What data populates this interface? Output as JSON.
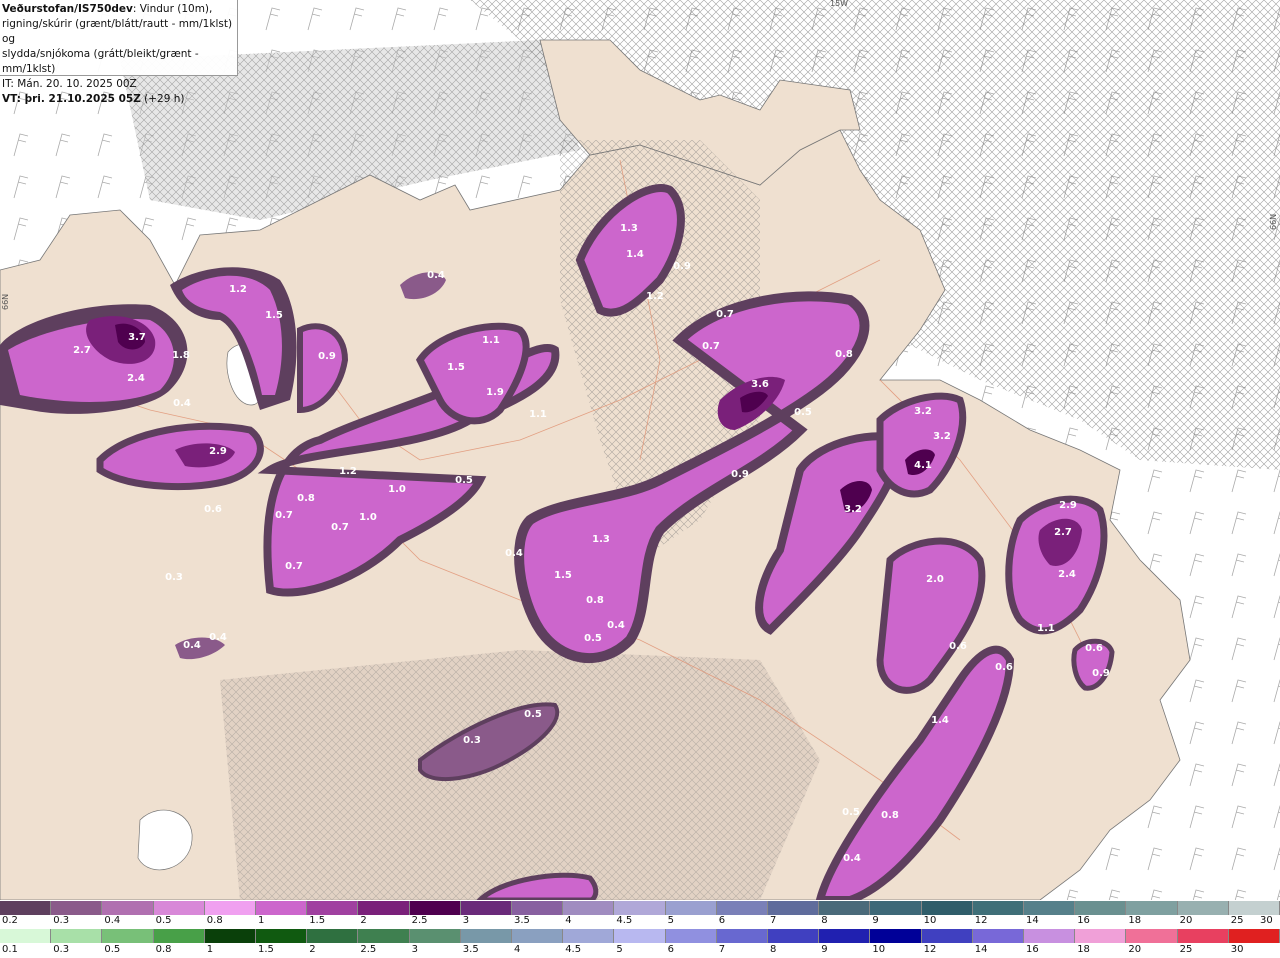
{
  "title": {
    "source": "Veðurstofan/IS750dev",
    "desc1": ": Vindur (10m),",
    "desc2": "rigning/skúrir (grænt/blátt/rautt - mm/1klst) og",
    "desc3": "slydda/snjókoma (grátt/bleikt/grænt - mm/1klst)",
    "it": "IT: Mán. 20. 10. 2025 00Z",
    "vt": "VT: þri. 21.10.2025 05Z",
    "vt_offset": "(+29 h)"
  },
  "edge_labels": {
    "top": "15W",
    "left": "66N",
    "right": "66N"
  },
  "colorbar_snow": {
    "ticks": [
      "0.2",
      "0.3",
      "0.4",
      "0.5",
      "0.8",
      "1",
      "1.5",
      "2",
      "2.5",
      "3",
      "3.5",
      "4",
      "4.5",
      "5",
      "6",
      "7",
      "8",
      "9",
      "10",
      "12",
      "14",
      "16",
      "18",
      "20",
      "25",
      "30"
    ],
    "colors": [
      "#5e3f5e",
      "#8a5a8a",
      "#b070b0",
      "#d888d8",
      "#f0a0f0",
      "#cc66cc",
      "#a040a0",
      "#7a207a",
      "#4f004f",
      "#6a2a7a",
      "#8860a0",
      "#a08cc0",
      "#b0a8d8",
      "#9aa0d0",
      "#7a80b8",
      "#5f6c9c",
      "#4a6a7a",
      "#3d6878",
      "#2f5d6a",
      "#3f6f78",
      "#56808a",
      "#6a9090",
      "#7fa0a0",
      "#98b0b0",
      "#c4d0d0"
    ]
  },
  "colorbar_rain": {
    "ticks": [
      "0.1",
      "0.3",
      "0.5",
      "0.8",
      "1",
      "1.5",
      "2",
      "2.5",
      "3",
      "3.5",
      "4",
      "4.5",
      "5",
      "6",
      "7",
      "8",
      "9",
      "10",
      "12",
      "14",
      "16",
      "18",
      "20",
      "25",
      "30"
    ],
    "colors": [
      "#d8f8d8",
      "#a8e0a8",
      "#78c078",
      "#48a048",
      "#0a400a",
      "#105a10",
      "#2f7040",
      "#3f8050",
      "#5a9070",
      "#7898a8",
      "#8aa0c0",
      "#a0a8d8",
      "#b8b8f0",
      "#9090e0",
      "#6868d0",
      "#4040c0",
      "#2020b0",
      "#000098",
      "#4040c0",
      "#7868d8",
      "#c890e0",
      "#f0a0d8",
      "#f07098",
      "#e84060",
      "#e02020"
    ]
  },
  "precip_labels": [
    "3.7",
    "2.7",
    "2.4",
    "1.8",
    "1.2",
    "1.5",
    "0.9",
    "0.4",
    "2.9",
    "0.6",
    "0.3",
    "0.4",
    "0.4",
    "0.4",
    "1.1",
    "1.5",
    "1.9",
    "1.1",
    "1.2",
    "1.0",
    "1.0",
    "0.7",
    "0.8",
    "0.7",
    "0.7",
    "0.5",
    "1.3",
    "1.4",
    "0.9",
    "1.2",
    "0.7",
    "0.7",
    "3.6",
    "0.8",
    "0.5",
    "0.9",
    "1.3",
    "1.5",
    "0.8",
    "0.5",
    "0.4",
    "0.4",
    "0.5",
    "0.3",
    "3.2",
    "3.2",
    "4.1",
    "3.2",
    "2.0",
    "2.9",
    "2.7",
    "2.4",
    "1.1",
    "0.6",
    "0.9",
    "0.6",
    "0.6",
    "1.4",
    "0.5",
    "0.8",
    "0.4"
  ]
}
